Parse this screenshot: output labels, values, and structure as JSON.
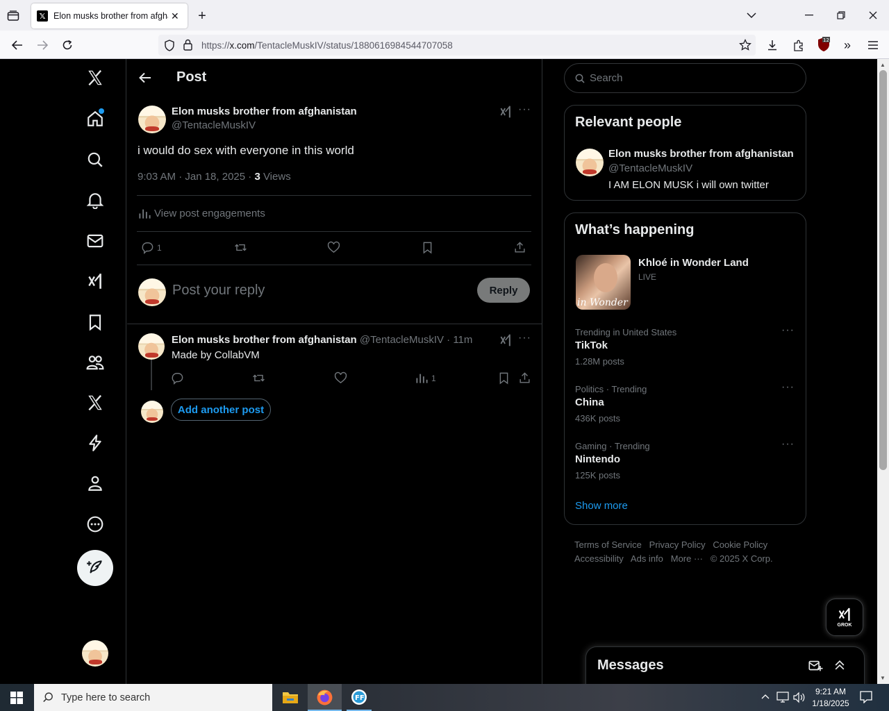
{
  "browser": {
    "tab_title": "Elon musks brother from afghanistan",
    "url_prefix": "https://",
    "url_domain": "x.com",
    "url_path": "/TentacleMuskIV/status/1880616984544707058"
  },
  "post_page": {
    "header_title": "Post",
    "author_name": "Elon musks brother from afghanistan",
    "author_handle": "@TentacleMuskIV",
    "text": "i would do sex with everyone in this world",
    "timestamp": "9:03 AM · Jan 18, 2025 · ",
    "views_count": "3",
    "views_label": " Views",
    "engagements": "View post engagements",
    "reply_count": "1",
    "reply_placeholder": "Post your reply",
    "reply_button": "Reply"
  },
  "reply_post": {
    "author_name": "Elon musks brother from afghanistan",
    "author_handle": "@TentacleMuskIV · 11m",
    "text": "Made by CollabVM",
    "views_count": "1",
    "add_another": "Add another post"
  },
  "sidebar": {
    "search_placeholder": "Search",
    "relevant_title": "Relevant people",
    "person_name": "Elon musks brother from afghanistan",
    "person_handle": "@TentacleMuskIV",
    "person_bio": "I AM ELON MUSK i will own twitter",
    "happening_title": "What’s happening",
    "live_title": "Khloé in Wonder Land",
    "live_label": "LIVE",
    "live_thumb_text": "in Wonder l",
    "trends": [
      {
        "context": "Trending in United States",
        "name": "TikTok",
        "posts": "1.28M posts"
      },
      {
        "context": "Politics · Trending",
        "name": "China",
        "posts": "436K posts"
      },
      {
        "context": "Gaming · Trending",
        "name": "Nintendo",
        "posts": "125K posts"
      }
    ],
    "show_more": "Show more",
    "footer_line1": [
      "Terms of Service",
      "Privacy Policy",
      "Cookie Policy"
    ],
    "footer_line2": [
      "Accessibility",
      "Ads info",
      "More ···",
      "© 2025 X Corp."
    ]
  },
  "grok_label": "GROK",
  "messages_title": "Messages",
  "taskbar": {
    "search_placeholder": "Type here to search",
    "time": "9:21 AM",
    "date": "1/18/2025"
  },
  "colors": {
    "accent": "#1d9bf0",
    "bg": "#000000",
    "border": "#2f3336",
    "muted": "#71767b"
  }
}
